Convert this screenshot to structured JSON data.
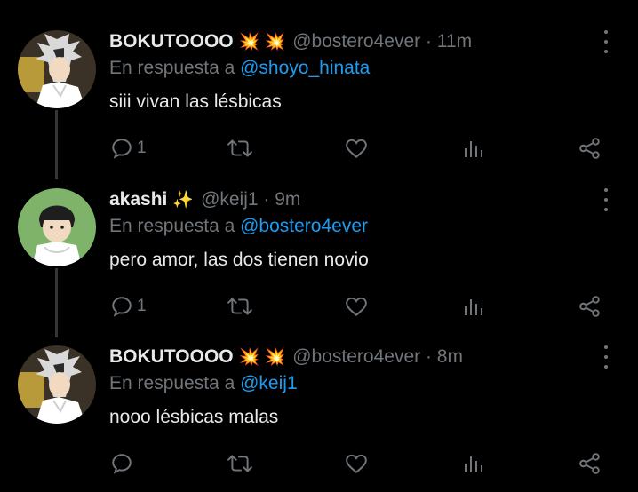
{
  "tweets": [
    {
      "name": "BOKUTOOOO",
      "emoji": "💥 💥",
      "handle_time": "@bostero4ever · 11m",
      "replying_prefix": "En respuesta a",
      "replying_to": "@shoyo_hinata",
      "text": "siii vivan las lésbicas",
      "reply_count": "1",
      "avatar": "bokuto-avatar"
    },
    {
      "name": "akashi",
      "emoji": "✨",
      "handle_time": "@keij1 · 9m",
      "replying_prefix": "En respuesta a",
      "replying_to": "@bostero4ever",
      "text": "pero amor, las dos tienen novio",
      "reply_count": "1",
      "avatar": "akashi-avatar"
    },
    {
      "name": "BOKUTOOOO",
      "emoji": "💥 💥",
      "handle_time": "@bostero4ever · 8m",
      "replying_prefix": "En respuesta a",
      "replying_to": "@keij1",
      "text": "nooo lésbicas malas",
      "reply_count": "",
      "avatar": "bokuto-avatar"
    }
  ],
  "icons": {
    "reply": "reply-icon",
    "retweet": "retweet-icon",
    "like": "heart-icon",
    "analytics": "analytics-icon",
    "share": "share-icon",
    "more": "more-icon"
  },
  "colors": {
    "background": "#000000",
    "text": "#e7e9ea",
    "muted": "#71767b",
    "link": "#1d9bf0"
  }
}
